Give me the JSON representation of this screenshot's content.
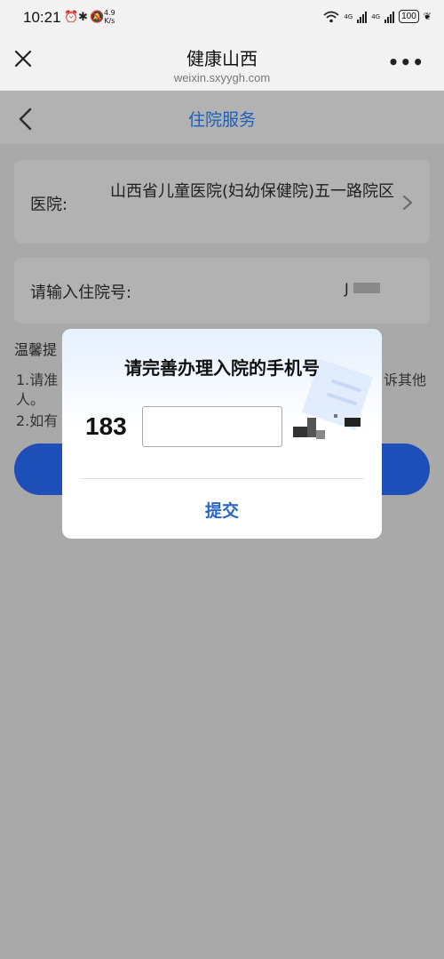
{
  "status_bar": {
    "time": "10:21",
    "speed_top": "4.9",
    "speed_bottom": "K/s",
    "net1": "4G",
    "net2": "4G",
    "battery": "100"
  },
  "wechat": {
    "title": "健康山西",
    "domain": "weixin.sxyygh.com"
  },
  "page": {
    "title": "住院服务"
  },
  "form": {
    "hospital_label": "医院:",
    "hospital_value": "山西省儿童医院(妇幼保健院)五一路院区",
    "inpatient_label": "请输入住院号:",
    "inpatient_value": "J"
  },
  "tips": {
    "title": "温馨提",
    "line1_start": "1.请准",
    "line1_end": "诉其他",
    "line1_wrap": "人。",
    "line2_start": "2.如有"
  },
  "dialog": {
    "title": "请完善办理入院的手机号",
    "phone_prefix": "183",
    "phone_value": "",
    "submit_label": "提交"
  }
}
